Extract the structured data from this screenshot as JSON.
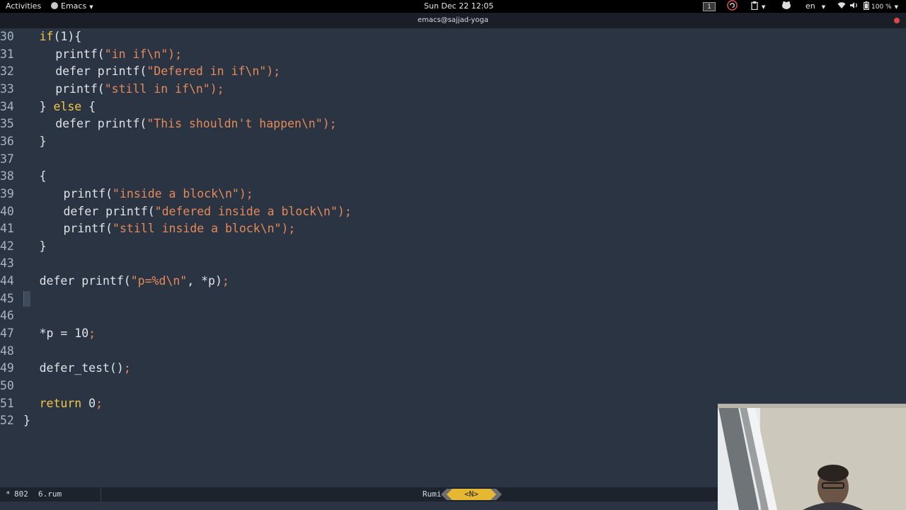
{
  "topbar": {
    "activities": "Activities",
    "app_name": "Emacs",
    "datetime": "Sun Dec 22  12:05",
    "workspace": "1",
    "language": "en",
    "battery": "100 %"
  },
  "window": {
    "title": "emacs@sajjad-yoga"
  },
  "editor": {
    "lines": [
      {
        "num": "30",
        "indent": 1,
        "tokens": [
          {
            "t": "if",
            "c": "kw"
          },
          {
            "t": "(1){",
            "c": ""
          }
        ]
      },
      {
        "num": "31",
        "indent": 2,
        "tokens": [
          {
            "t": "printf(",
            "c": ""
          },
          {
            "t": "\"in if\\n\"",
            "c": "str"
          },
          {
            "t": ");",
            "c": "semi"
          }
        ]
      },
      {
        "num": "32",
        "indent": 2,
        "tokens": [
          {
            "t": "defer printf(",
            "c": ""
          },
          {
            "t": "\"Defered in if\\n\"",
            "c": "str"
          },
          {
            "t": ");",
            "c": "semi"
          }
        ]
      },
      {
        "num": "33",
        "indent": 2,
        "tokens": [
          {
            "t": "printf(",
            "c": ""
          },
          {
            "t": "\"still in if\\n\"",
            "c": "str"
          },
          {
            "t": ");",
            "c": "semi"
          }
        ]
      },
      {
        "num": "34",
        "indent": 1,
        "tokens": [
          {
            "t": "} ",
            "c": ""
          },
          {
            "t": "else",
            "c": "kw"
          },
          {
            "t": " {",
            "c": ""
          }
        ]
      },
      {
        "num": "35",
        "indent": 2,
        "tokens": [
          {
            "t": "defer printf(",
            "c": ""
          },
          {
            "t": "\"This shouldn't happen\\n\"",
            "c": "str"
          },
          {
            "t": ");",
            "c": "semi"
          }
        ]
      },
      {
        "num": "36",
        "indent": 1,
        "tokens": [
          {
            "t": "}",
            "c": ""
          }
        ]
      },
      {
        "num": "37",
        "indent": 0,
        "tokens": []
      },
      {
        "num": "38",
        "indent": 1,
        "tokens": [
          {
            "t": "{",
            "c": ""
          }
        ]
      },
      {
        "num": "39",
        "indent": 3,
        "tokens": [
          {
            "t": "printf(",
            "c": ""
          },
          {
            "t": "\"inside a block\\n\"",
            "c": "str"
          },
          {
            "t": ");",
            "c": "semi"
          }
        ]
      },
      {
        "num": "40",
        "indent": 3,
        "tokens": [
          {
            "t": "defer printf(",
            "c": ""
          },
          {
            "t": "\"defered inside a block\\n\"",
            "c": "str"
          },
          {
            "t": ");",
            "c": "semi"
          }
        ]
      },
      {
        "num": "41",
        "indent": 3,
        "tokens": [
          {
            "t": "printf(",
            "c": ""
          },
          {
            "t": "\"still inside a block\\n\"",
            "c": "str"
          },
          {
            "t": ");",
            "c": "semi"
          }
        ]
      },
      {
        "num": "42",
        "indent": 1,
        "tokens": [
          {
            "t": "}",
            "c": ""
          }
        ]
      },
      {
        "num": "43",
        "indent": 0,
        "tokens": []
      },
      {
        "num": "44",
        "indent": 1,
        "tokens": [
          {
            "t": "defer printf(",
            "c": ""
          },
          {
            "t": "\"p=%d\\n\"",
            "c": "str"
          },
          {
            "t": ", *p)",
            "c": ""
          },
          {
            "t": ";",
            "c": "semi"
          }
        ]
      },
      {
        "num": "45",
        "indent": 0,
        "tokens": [],
        "cursor": true
      },
      {
        "num": "46",
        "indent": 0,
        "tokens": []
      },
      {
        "num": "47",
        "indent": 1,
        "tokens": [
          {
            "t": "*p = 10",
            "c": ""
          },
          {
            "t": ";",
            "c": "semi"
          }
        ]
      },
      {
        "num": "48",
        "indent": 0,
        "tokens": []
      },
      {
        "num": "49",
        "indent": 1,
        "tokens": [
          {
            "t": "defer_test()",
            "c": ""
          },
          {
            "t": ";",
            "c": "semi"
          }
        ]
      },
      {
        "num": "50",
        "indent": 0,
        "tokens": []
      },
      {
        "num": "51",
        "indent": 1,
        "tokens": [
          {
            "t": "return",
            "c": "kw"
          },
          {
            "t": " 0",
            "c": ""
          },
          {
            "t": ";",
            "c": "semi"
          }
        ]
      },
      {
        "num": "52",
        "indent": 0,
        "tokens": [
          {
            "t": "}",
            "c": ""
          }
        ]
      }
    ]
  },
  "modeline": {
    "modified": "*",
    "size": "802",
    "filename": "6.rum",
    "major_mode": "Rumi",
    "evil_state": "<N>"
  },
  "colors": {
    "background": "#2b3442",
    "keyword": "#f2c744",
    "string": "#e48a5a",
    "evil_normal": "#e5b733"
  }
}
